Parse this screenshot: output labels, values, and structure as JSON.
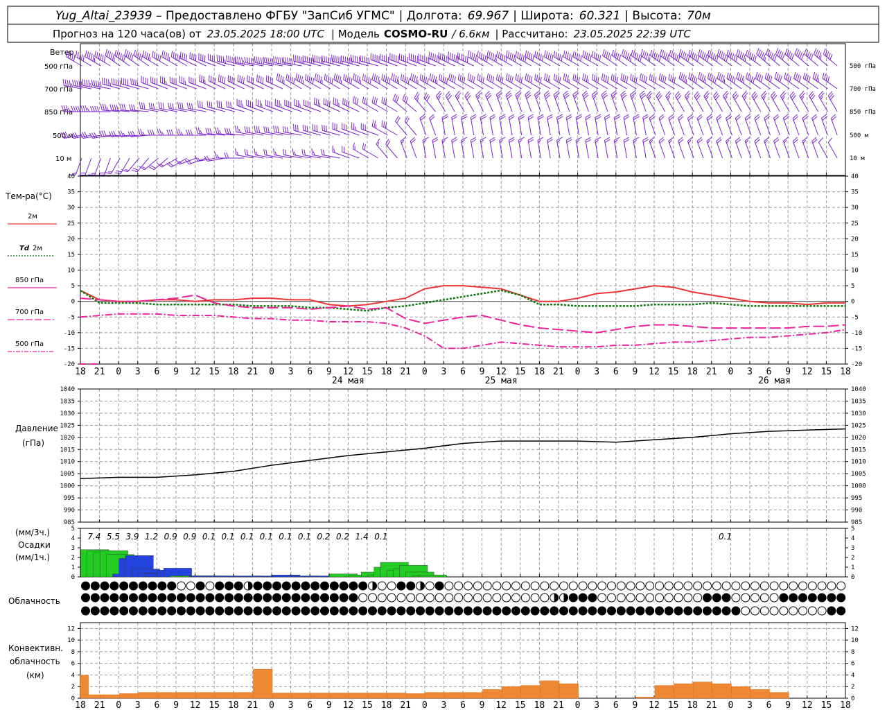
{
  "header": {
    "station": "Yug_Altai_23939",
    "provider": " – Предоставлено ФГБУ \"ЗапСиб УГМС\"",
    "lon_label": "| Долгота:",
    "lon": "69.967",
    "lat_label": "| Широта:",
    "lat": "60.321",
    "alt_label": "| Высота:",
    "alt": "70м",
    "fc_label": "Прогноз на 120 часа(ов) от",
    "fc_date": "23.05.2025 18:00 UTC",
    "model_label": "| Модель",
    "model": "COSMO-RU",
    "res": "/ 6.6км",
    "calc_label": "| Рассчитано:",
    "calc": "23.05.2025 22:39 UTC"
  },
  "labels": {
    "wind": "Ветер",
    "wind_levels": [
      "500 гПа",
      "700 гПа",
      "850 гПа",
      "500  м",
      "10   м"
    ],
    "temp": "Тем-ра(°C)",
    "t2m": "2м",
    "td": "Td",
    "td2": "2м",
    "t850": "850 гПа",
    "t700": "700 гПа",
    "t500": "500 гПа",
    "pres1": "Давление",
    "pres2": "(гПа)",
    "prec1": "(мм/3ч.)",
    "prec2": "Осадки",
    "prec3": "(мм/1ч.)",
    "cloud": "Облачность",
    "conv1": "Конвективн.",
    "conv2": "облачность",
    "conv3": "(км)"
  },
  "colors": {
    "t2m": "#ee3333",
    "td": "#117711",
    "t850": "#ee2299",
    "t700": "#ee2299",
    "t500": "#ee2299",
    "wind": "#7722cc",
    "pres": "#000000",
    "prec_green": "#22cc22",
    "prec_blue": "#2244dd",
    "conv": "#ee8833"
  },
  "chart_data": [
    {
      "type": "line",
      "title": "Тем-ра(°C)",
      "x_hours": [
        0,
        3,
        6,
        9,
        12,
        15,
        18,
        21,
        24,
        27,
        30,
        33,
        36,
        39,
        42,
        45,
        48,
        51,
        54,
        57,
        60,
        63,
        66,
        69,
        72,
        75,
        78,
        81,
        84,
        87,
        90,
        93,
        96,
        99,
        102,
        105,
        108,
        111,
        114,
        117,
        120
      ],
      "xtick_labels": [
        "18",
        "21",
        "0",
        "3",
        "6",
        "9",
        "12",
        "15",
        "18",
        "21",
        "0",
        "3",
        "6",
        "9",
        "12",
        "15",
        "18",
        "21",
        "0",
        "3",
        "6",
        "9",
        "12",
        "15",
        "18",
        "21",
        "0",
        "3",
        "6",
        "9",
        "12",
        "15",
        "18",
        "21",
        "0",
        "3",
        "6",
        "9",
        "12",
        "15",
        "18",
        "21",
        "0"
      ],
      "day_labels": [
        "24 мая",
        "25 мая",
        "26 мая"
      ],
      "ylim": [
        -20,
        40
      ],
      "yticks": [
        -20,
        -15,
        -10,
        -5,
        0,
        5,
        10,
        15,
        20,
        25,
        30,
        35,
        40
      ],
      "series": [
        {
          "name": "2м",
          "values": [
            3.5,
            0.5,
            0,
            0,
            0.5,
            0.5,
            0,
            0.5,
            0.5,
            1,
            1,
            0.5,
            0.5,
            -1,
            -1.5,
            -1,
            0,
            1,
            4,
            5,
            5,
            4.5,
            4,
            2,
            0,
            0,
            1,
            2.5,
            3,
            4,
            5,
            4.5,
            3,
            2,
            1,
            0,
            -0.5,
            -0.5,
            -1,
            -0.5,
            -0.5
          ]
        },
        {
          "name": "Td 2м",
          "values": [
            3.5,
            -0.5,
            -0.5,
            -0.5,
            -1,
            -1,
            -1,
            -1,
            -1,
            -1.5,
            -1.5,
            -1.5,
            -2,
            -2,
            -2.5,
            -3,
            -2,
            -1.5,
            -0.5,
            0.5,
            1.5,
            2.5,
            3.5,
            2,
            -1,
            -1,
            -1.5,
            -1.5,
            -1.5,
            -1.5,
            -1,
            -1,
            -1,
            -0.5,
            -1,
            -1.5,
            -1.5,
            -1.5,
            -1.5,
            -1.5,
            -1.5
          ]
        },
        {
          "name": "850 гПа",
          "values": [
            1,
            0.5,
            0,
            0,
            0.5,
            1,
            2,
            -0.5,
            -1.5,
            -2,
            -2,
            -2,
            -2.5,
            -2,
            -1.5,
            -2.5,
            -2,
            -5.5,
            -7,
            -6,
            -5,
            -4.5,
            -6,
            -7.5,
            -8.5,
            -9,
            -9.5,
            -10,
            -9,
            -8,
            -7.5,
            -7.5,
            -8,
            -8.5,
            -8.5,
            -8.5,
            -8.5,
            -8.5,
            -8,
            -8,
            -7.5
          ]
        },
        {
          "name": "700 гПа",
          "values": [
            -5,
            -4.5,
            -4,
            -4,
            -4,
            -4.5,
            -4.5,
            -4.5,
            -5,
            -5.5,
            -5.5,
            -6,
            -6,
            -6.5,
            -6.5,
            -6.5,
            -7,
            -8.5,
            -11,
            -15,
            -15,
            -14,
            -13,
            -13.5,
            -14,
            -14.5,
            -14.5,
            -14.5,
            -14,
            -14,
            -13.5,
            -13,
            -13,
            -12.5,
            -12,
            -11.5,
            -11.5,
            -11,
            -10.5,
            -10,
            -9
          ]
        },
        {
          "name": "500 гПа",
          "values": [
            -20,
            -20
          ]
        }
      ]
    },
    {
      "type": "line",
      "title": "Давление (гПа)",
      "x_hours": [
        0,
        6,
        12,
        18,
        24,
        30,
        36,
        42,
        48,
        54,
        60,
        66,
        72,
        78,
        84,
        90,
        96,
        102,
        108,
        114,
        120
      ],
      "ylim": [
        985,
        1040
      ],
      "yticks": [
        985,
        990,
        995,
        1000,
        1005,
        1010,
        1015,
        1020,
        1025,
        1030,
        1035,
        1040
      ],
      "series": [
        {
          "name": "",
          "values": [
            1003,
            1003.5,
            1003.5,
            1004.5,
            1006,
            1008.5,
            1010.5,
            1012.5,
            1014,
            1015.5,
            1017.5,
            1018.5,
            1018.5,
            1018.5,
            1018,
            1019,
            1020,
            1021.5,
            1022.5,
            1023,
            1023.5
          ]
        }
      ]
    },
    {
      "type": "bar",
      "title": "Осадки",
      "ylim": [
        0,
        5
      ],
      "yticks": [
        0,
        1,
        2,
        3,
        4,
        5
      ],
      "totals_3h": [
        "7.4",
        "5.5",
        "3.9",
        "1.2",
        "0.9",
        "0.9",
        "0.1",
        "0.1",
        "0.1",
        "0.1",
        "0.1",
        "0.1",
        "0.2",
        "0.2",
        "1.4",
        "0.1",
        "0.1"
      ],
      "totals_x_hours": [
        1.5,
        4.5,
        7.5,
        10.5,
        13.5,
        16.5,
        19.5,
        22.5,
        25.5,
        28.5,
        31.5,
        34.5,
        37.5,
        40.5,
        43.5,
        46.5,
        100.5
      ],
      "hourly_values": [
        2.8,
        2.7,
        2.5,
        2.7,
        2.3,
        0.3,
        1.9,
        2.2,
        0.8,
        0.4,
        0.3,
        0.3,
        0.7,
        0.9,
        0.1,
        0.1,
        0.1,
        0.1,
        0.1,
        0.1,
        0.1,
        0.1,
        0.1,
        0.2,
        0.1,
        0.1,
        0.3,
        0.2,
        0.5,
        0.2,
        1.0,
        1.5,
        0.7,
        0.8,
        1.2,
        0.5,
        0.1,
        0.2
      ],
      "hourly_x_hours": [
        0,
        1,
        2,
        3,
        4,
        5,
        6,
        7,
        8,
        9,
        10,
        11,
        12,
        13,
        14,
        15,
        16,
        17,
        18,
        19,
        20,
        24,
        27,
        30,
        33,
        36,
        39,
        42,
        44,
        45,
        46,
        47,
        48,
        49,
        50,
        51,
        52,
        53
      ],
      "hourly_kind": [
        "g",
        "g",
        "g",
        "g",
        "g",
        "b",
        "b",
        "b",
        "b",
        "b",
        "b",
        "b",
        "b",
        "b",
        "g",
        "g",
        "g",
        "b",
        "b",
        "b",
        "b",
        "b",
        "b",
        "b",
        "b",
        "b",
        "g",
        "g",
        "g",
        "g",
        "g",
        "g",
        "g",
        "g",
        "g",
        "g",
        "g",
        "g"
      ]
    },
    {
      "type": "table",
      "title": "Облачность",
      "rows": [
        "888888888800808884888888888888400884080000000000000000000000000000000000000000000000000000048448848884888888",
        "8888888888888888888888888888800000000000000000000448880000000000088800000888888888884888888888888888888888888888",
        "888888888888888888888888888888888888888888888888888888888888888888888000000000888888888880000888888888000000000000"
      ]
    },
    {
      "type": "bar",
      "title": "Конвективн. облачность (км)",
      "ylim": [
        0,
        13
      ],
      "yticks": [
        0,
        2,
        4,
        6,
        8,
        10,
        12
      ],
      "x_hours": [
        0,
        3,
        6,
        9,
        12,
        15,
        18,
        21,
        24,
        27,
        30,
        33,
        36,
        39,
        42,
        45,
        48,
        51,
        54,
        57,
        60,
        63,
        66,
        69,
        72,
        75,
        78,
        81,
        84,
        87,
        90,
        93,
        96,
        99,
        102,
        105,
        108,
        111,
        114,
        117
      ],
      "values": [
        0.6,
        0.6,
        0.8,
        1.0,
        1.0,
        1.0,
        1.0,
        1.0,
        1.0,
        5.0,
        0.9,
        0.9,
        0.9,
        0.9,
        0.9,
        0.9,
        0.9,
        0.8,
        1.0,
        1.0,
        1.0,
        1.5,
        2.0,
        2.2,
        3.0,
        2.5,
        0,
        0,
        0,
        0.2,
        2.2,
        2.5,
        2.8,
        2.5,
        2.0,
        1.5,
        1.0,
        0,
        0,
        0
      ],
      "first_value": 4.0
    },
    {
      "type": "wind",
      "title": "Ветер",
      "levels": [
        "500 гПа",
        "700 гПа",
        "850 гПа",
        "500  м",
        "10   м"
      ],
      "dir_deg": [
        [
          300,
          300,
          305,
          305,
          300,
          300,
          295,
          290,
          285,
          280,
          280,
          280,
          285,
          285,
          285,
          285,
          290,
          290,
          290,
          295,
          295,
          300,
          300,
          300,
          300,
          300,
          300,
          300,
          305,
          305,
          305,
          305,
          305,
          305,
          305,
          305,
          310,
          310,
          310,
          310
        ],
        [
          280,
          280,
          285,
          285,
          290,
          290,
          290,
          295,
          295,
          295,
          295,
          300,
          300,
          300,
          300,
          300,
          300,
          300,
          300,
          300,
          300,
          300,
          300,
          300,
          300,
          300,
          300,
          300,
          300,
          300,
          300,
          300,
          305,
          305,
          305,
          305,
          305,
          305,
          305,
          305
        ],
        [
          270,
          270,
          275,
          275,
          280,
          280,
          280,
          285,
          285,
          290,
          290,
          290,
          290,
          295,
          295,
          300,
          300,
          310,
          320,
          330,
          330,
          335,
          340,
          340,
          340,
          340,
          340,
          340,
          340,
          340,
          330,
          330,
          330,
          330,
          330,
          330,
          330,
          330,
          330,
          330
        ],
        [
          260,
          260,
          265,
          265,
          270,
          270,
          270,
          275,
          275,
          280,
          280,
          280,
          285,
          285,
          290,
          290,
          300,
          320,
          340,
          350,
          350,
          350,
          350,
          350,
          350,
          350,
          350,
          350,
          350,
          350,
          340,
          340,
          340,
          340,
          340,
          340,
          340,
          340,
          340,
          340
        ],
        [
          200,
          200,
          210,
          220,
          230,
          240,
          250,
          260,
          270,
          280,
          280,
          280,
          280,
          280,
          290,
          300,
          320,
          340,
          350,
          350,
          350,
          350,
          350,
          350,
          350,
          350,
          350,
          350,
          350,
          350,
          340,
          340,
          340,
          340,
          340,
          340,
          340,
          340,
          340,
          330
        ]
      ],
      "speed_ms": [
        [
          20,
          22,
          22,
          20,
          18,
          18,
          16,
          16,
          18,
          18,
          20,
          22,
          22,
          22,
          22,
          20,
          20,
          20,
          22,
          24,
          24,
          22,
          22,
          22,
          20,
          20,
          20,
          20,
          20,
          22,
          22,
          22,
          24,
          24,
          24,
          22,
          22,
          20,
          20,
          18
        ],
        [
          18,
          18,
          18,
          16,
          16,
          14,
          14,
          14,
          16,
          16,
          16,
          18,
          18,
          18,
          18,
          18,
          18,
          18,
          18,
          18,
          16,
          16,
          16,
          16,
          16,
          14,
          14,
          14,
          16,
          16,
          16,
          16,
          18,
          18,
          18,
          18,
          16,
          16,
          16,
          14
        ],
        [
          14,
          14,
          14,
          12,
          12,
          12,
          12,
          12,
          12,
          14,
          14,
          14,
          14,
          14,
          14,
          12,
          12,
          12,
          10,
          10,
          10,
          10,
          10,
          10,
          10,
          10,
          10,
          10,
          10,
          10,
          10,
          10,
          10,
          10,
          10,
          10,
          10,
          10,
          10,
          10
        ],
        [
          12,
          12,
          12,
          10,
          10,
          10,
          10,
          10,
          10,
          10,
          12,
          12,
          12,
          12,
          12,
          10,
          10,
          8,
          8,
          8,
          8,
          8,
          8,
          8,
          8,
          8,
          8,
          8,
          8,
          8,
          8,
          8,
          8,
          8,
          8,
          8,
          8,
          8,
          8,
          8
        ],
        [
          6,
          6,
          6,
          6,
          6,
          6,
          6,
          6,
          6,
          6,
          6,
          6,
          6,
          6,
          6,
          6,
          6,
          6,
          6,
          6,
          6,
          6,
          6,
          6,
          6,
          6,
          6,
          6,
          6,
          6,
          6,
          6,
          6,
          6,
          6,
          6,
          6,
          6,
          6,
          4
        ]
      ]
    }
  ]
}
